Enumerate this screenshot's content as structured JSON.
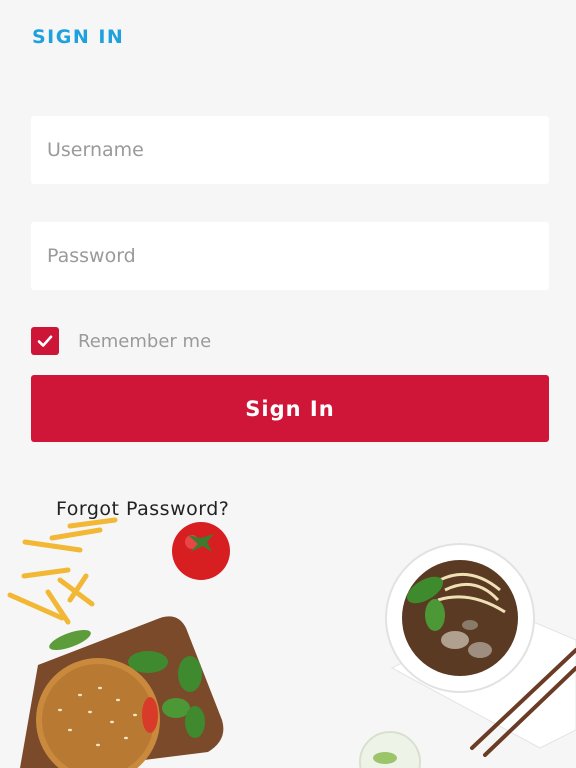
{
  "header": {
    "title": "SIGN IN"
  },
  "form": {
    "username_placeholder": "Username",
    "password_placeholder": "Password",
    "remember_label": "Remember me",
    "remember_checked": true,
    "submit_label": "Sign In",
    "forgot_label": "Forgot Password?"
  },
  "colors": {
    "accent_blue": "#1ea1dc",
    "primary_red": "#d01638",
    "background": "#f6f6f6"
  },
  "icons": {
    "checkbox_mark": "check-icon"
  },
  "decor": {
    "items": [
      "fries",
      "tomato",
      "burger",
      "noodle-bowl",
      "chopsticks",
      "drink-glass"
    ]
  }
}
